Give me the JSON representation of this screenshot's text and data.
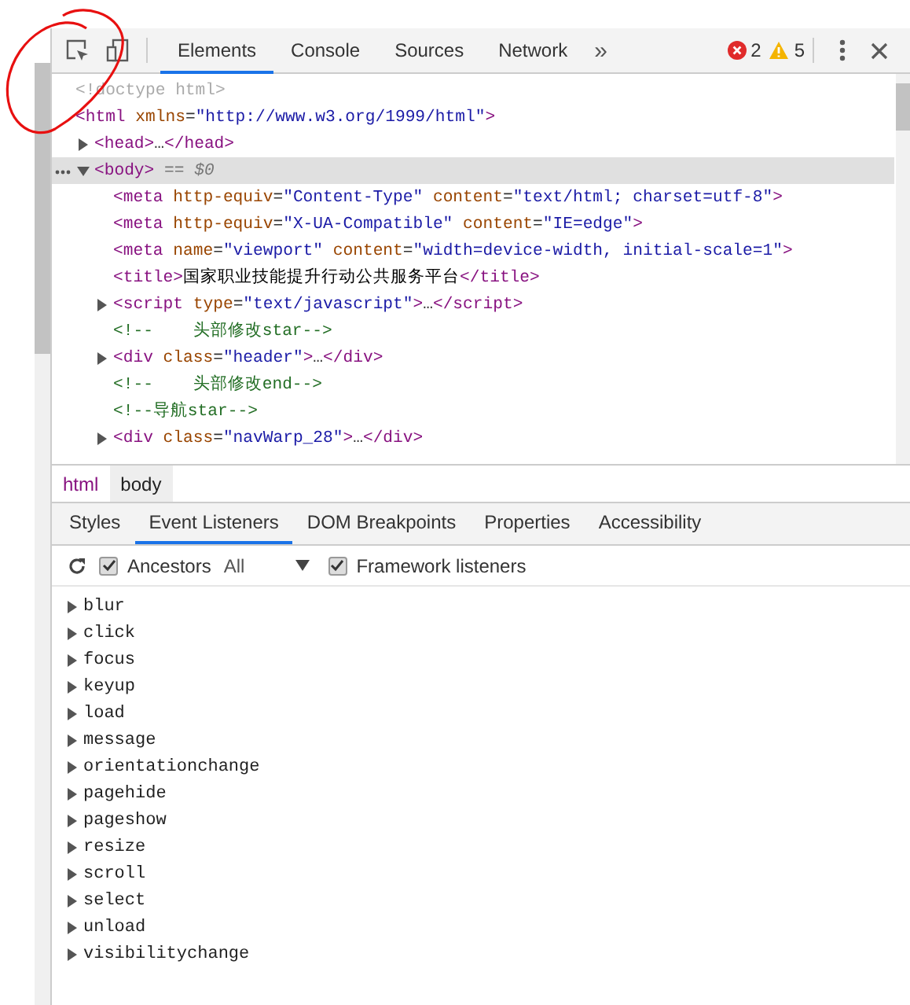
{
  "toolbar": {
    "tabs": [
      {
        "label": "Elements",
        "selected": true
      },
      {
        "label": "Console",
        "selected": false
      },
      {
        "label": "Sources",
        "selected": false
      },
      {
        "label": "Network",
        "selected": false
      }
    ],
    "overflow": "»",
    "errors": "2",
    "warnings": "5"
  },
  "dom": [
    {
      "tokens": [
        {
          "kind": "doctype",
          "text": "<!doctype html>"
        }
      ]
    },
    {
      "tokens": [
        {
          "kind": "tag",
          "text": "<html"
        },
        {
          "kind": "attr",
          "text": " xmlns"
        },
        {
          "kind": "plain",
          "text": "="
        },
        {
          "kind": "value",
          "text": "\"http://www.w3.org/1999/html\""
        },
        {
          "kind": "tag",
          "text": ">"
        }
      ],
      "children": [
        {
          "expanded": false,
          "tokens": [
            {
              "kind": "tag",
              "text": "<head>"
            },
            {
              "kind": "plain",
              "text": "…"
            },
            {
              "kind": "tag",
              "text": "</head>"
            }
          ]
        },
        {
          "expanded": true,
          "selected": true,
          "tokens": [
            {
              "kind": "tag",
              "text": "<body>"
            },
            {
              "kind": "marker",
              "text": " == $0"
            }
          ],
          "children": [
            {
              "tokens": [
                {
                  "kind": "tag",
                  "text": "<meta"
                },
                {
                  "kind": "attr",
                  "text": " http-equiv"
                },
                {
                  "kind": "plain",
                  "text": "="
                },
                {
                  "kind": "value",
                  "text": "\"Content-Type\""
                },
                {
                  "kind": "attr",
                  "text": " content"
                },
                {
                  "kind": "plain",
                  "text": "="
                },
                {
                  "kind": "value",
                  "text": "\"text/html; charset=utf-8\""
                },
                {
                  "kind": "tag",
                  "text": ">"
                }
              ]
            },
            {
              "tokens": [
                {
                  "kind": "tag",
                  "text": "<meta"
                },
                {
                  "kind": "attr",
                  "text": " http-equiv"
                },
                {
                  "kind": "plain",
                  "text": "="
                },
                {
                  "kind": "value",
                  "text": "\"X-UA-Compatible\""
                },
                {
                  "kind": "attr",
                  "text": " content"
                },
                {
                  "kind": "plain",
                  "text": "="
                },
                {
                  "kind": "value",
                  "text": "\"IE=edge\""
                },
                {
                  "kind": "tag",
                  "text": ">"
                }
              ]
            },
            {
              "tokens": [
                {
                  "kind": "tag",
                  "text": "<meta"
                },
                {
                  "kind": "attr",
                  "text": " name"
                },
                {
                  "kind": "plain",
                  "text": "="
                },
                {
                  "kind": "value",
                  "text": "\"viewport\""
                },
                {
                  "kind": "attr",
                  "text": " content"
                },
                {
                  "kind": "plain",
                  "text": "="
                },
                {
                  "kind": "value",
                  "text": "\"width=device-width, initial-scale=1\""
                },
                {
                  "kind": "tag",
                  "text": ">"
                }
              ]
            },
            {
              "tokens": [
                {
                  "kind": "tag",
                  "text": "<title>"
                },
                {
                  "kind": "text",
                  "text": "国家职业技能提升行动公共服务平台"
                },
                {
                  "kind": "tag",
                  "text": "</title>"
                }
              ]
            },
            {
              "expanded": false,
              "tokens": [
                {
                  "kind": "tag",
                  "text": "<script"
                },
                {
                  "kind": "attr",
                  "text": " type"
                },
                {
                  "kind": "plain",
                  "text": "="
                },
                {
                  "kind": "value",
                  "text": "\"text/javascript\""
                },
                {
                  "kind": "tag",
                  "text": ">"
                },
                {
                  "kind": "plain",
                  "text": "…"
                },
                {
                  "kind": "tag",
                  "text": "</script>"
                }
              ]
            },
            {
              "tokens": [
                {
                  "kind": "comment",
                  "text": "<!--    头部修改star-->"
                }
              ]
            },
            {
              "expanded": false,
              "tokens": [
                {
                  "kind": "tag",
                  "text": "<div"
                },
                {
                  "kind": "attr",
                  "text": " class"
                },
                {
                  "kind": "plain",
                  "text": "="
                },
                {
                  "kind": "value",
                  "text": "\"header\""
                },
                {
                  "kind": "tag",
                  "text": ">"
                },
                {
                  "kind": "plain",
                  "text": "…"
                },
                {
                  "kind": "tag",
                  "text": "</div>"
                }
              ]
            },
            {
              "tokens": [
                {
                  "kind": "comment",
                  "text": "<!--    头部修改end-->"
                }
              ]
            },
            {
              "tokens": [
                {
                  "kind": "comment",
                  "text": "<!--导航star-->"
                }
              ]
            },
            {
              "expanded": false,
              "tokens": [
                {
                  "kind": "tag",
                  "text": "<div"
                },
                {
                  "kind": "attr",
                  "text": " class"
                },
                {
                  "kind": "plain",
                  "text": "="
                },
                {
                  "kind": "value",
                  "text": "\"navWarp_28\""
                },
                {
                  "kind": "tag",
                  "text": ">"
                },
                {
                  "kind": "plain",
                  "text": "…"
                },
                {
                  "kind": "tag",
                  "text": "</div>"
                }
              ]
            }
          ]
        }
      ]
    }
  ],
  "breadcrumbs": [
    {
      "label": "html",
      "selected": false
    },
    {
      "label": "body",
      "selected": true
    }
  ],
  "subtabs": [
    {
      "label": "Styles",
      "selected": false
    },
    {
      "label": "Event Listeners",
      "selected": true
    },
    {
      "label": "DOM Breakpoints",
      "selected": false
    },
    {
      "label": "Properties",
      "selected": false
    },
    {
      "label": "Accessibility",
      "selected": false
    }
  ],
  "filter": {
    "ancestors": {
      "label": "Ancestors",
      "checked": true
    },
    "scope": "All",
    "framework": {
      "label": "Framework listeners",
      "checked": true
    }
  },
  "events": [
    {
      "name": "blur",
      "expanded": false
    },
    {
      "name": "click",
      "expanded": false
    },
    {
      "name": "focus",
      "expanded": false
    },
    {
      "name": "keyup",
      "expanded": false
    },
    {
      "name": "load",
      "expanded": false
    },
    {
      "name": "message",
      "expanded": false
    },
    {
      "name": "orientationchange",
      "expanded": false
    },
    {
      "name": "pagehide",
      "expanded": false
    },
    {
      "name": "pageshow",
      "expanded": false
    },
    {
      "name": "resize",
      "expanded": false
    },
    {
      "name": "scroll",
      "expanded": false
    },
    {
      "name": "select",
      "expanded": false
    },
    {
      "name": "unload",
      "expanded": false
    },
    {
      "name": "visibilitychange",
      "expanded": false
    }
  ]
}
